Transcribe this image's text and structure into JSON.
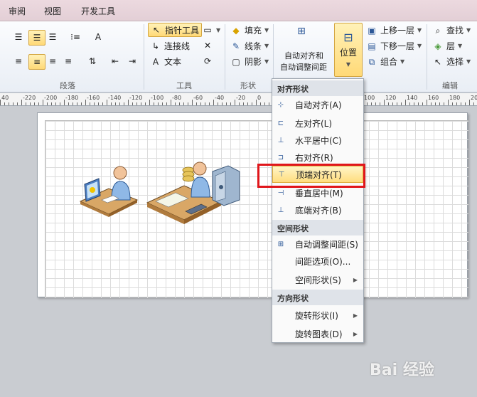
{
  "tabs": [
    "审阅",
    "视图",
    "开发工具"
  ],
  "ribbon": {
    "groups": {
      "paragraph": "段落",
      "tools": "工具",
      "shape": "形状",
      "edit": "编辑"
    },
    "tools": {
      "pointer": "指针工具",
      "connector": "连接线",
      "text": "文本"
    },
    "shape": {
      "fill": "填充",
      "line": "线条",
      "shadow": "阴影"
    },
    "arrange": {
      "auto_align_line1": "自动对齐和",
      "auto_align_line2": "自动调整间距",
      "position": "位置",
      "bring_forward": "上移一层",
      "send_backward": "下移一层",
      "group": "组合"
    },
    "edit": {
      "find": "查找",
      "layer": "层",
      "select": "选择"
    }
  },
  "ruler": [
    "40",
    "-220",
    "-200",
    "-180",
    "-160",
    "-140",
    "-120",
    "-100",
    "-80",
    "-60",
    "-40",
    "-20",
    "0",
    "20",
    "40",
    "60",
    "80",
    "100",
    "120",
    "140",
    "160",
    "180",
    "200"
  ],
  "menu": {
    "header_align": "对齐形状",
    "auto_align": "自动对齐(A)",
    "left": "左对齐(L)",
    "center_h": "水平居中(C)",
    "right": "右对齐(R)",
    "top": "顶端对齐(T)",
    "middle_v": "垂直居中(M)",
    "bottom": "底端对齐(B)",
    "header_space": "空间形状",
    "auto_space": "自动调整间距(S)",
    "spacing_options": "间距选项(O)...",
    "space_shapes": "空间形状(S)",
    "header_orient": "方向形状",
    "rotate_shapes": "旋转形状(I)",
    "rotate_diagram": "旋转图表(D)"
  },
  "watermark": "Bai 经验"
}
